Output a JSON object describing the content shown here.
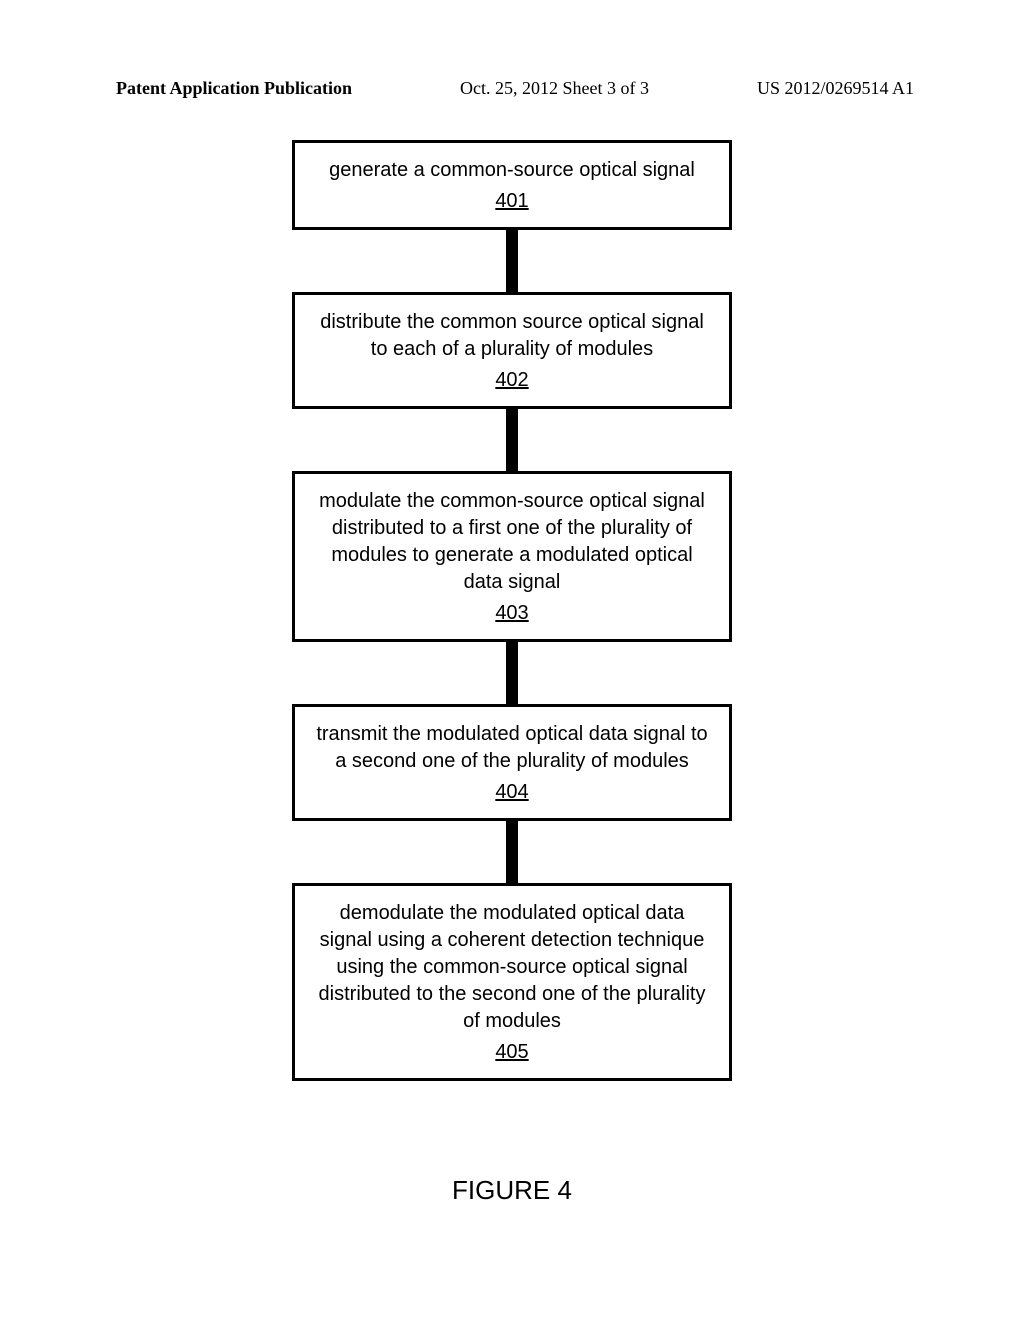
{
  "header": {
    "left": "Patent Application Publication",
    "mid": "Oct. 25, 2012  Sheet 3 of 3",
    "right": "US 2012/0269514 A1"
  },
  "flow": {
    "boxes": [
      {
        "text": "generate a common-source optical signal",
        "ref": "401"
      },
      {
        "text": "distribute the common source optical signal to each of a plurality of modules",
        "ref": "402"
      },
      {
        "text": "modulate the common-source optical signal distributed to a first one of the plurality of modules to generate a modulated optical data signal",
        "ref": "403"
      },
      {
        "text": "transmit the modulated optical data signal to a second one of the plurality of modules",
        "ref": "404"
      },
      {
        "text": "demodulate the modulated optical data signal using a coherent detection technique using the common-source optical signal distributed to the second one of the plurality of modules",
        "ref": "405"
      }
    ],
    "connector_heights": [
      62,
      62,
      62,
      62
    ]
  },
  "caption": "FIGURE 4"
}
